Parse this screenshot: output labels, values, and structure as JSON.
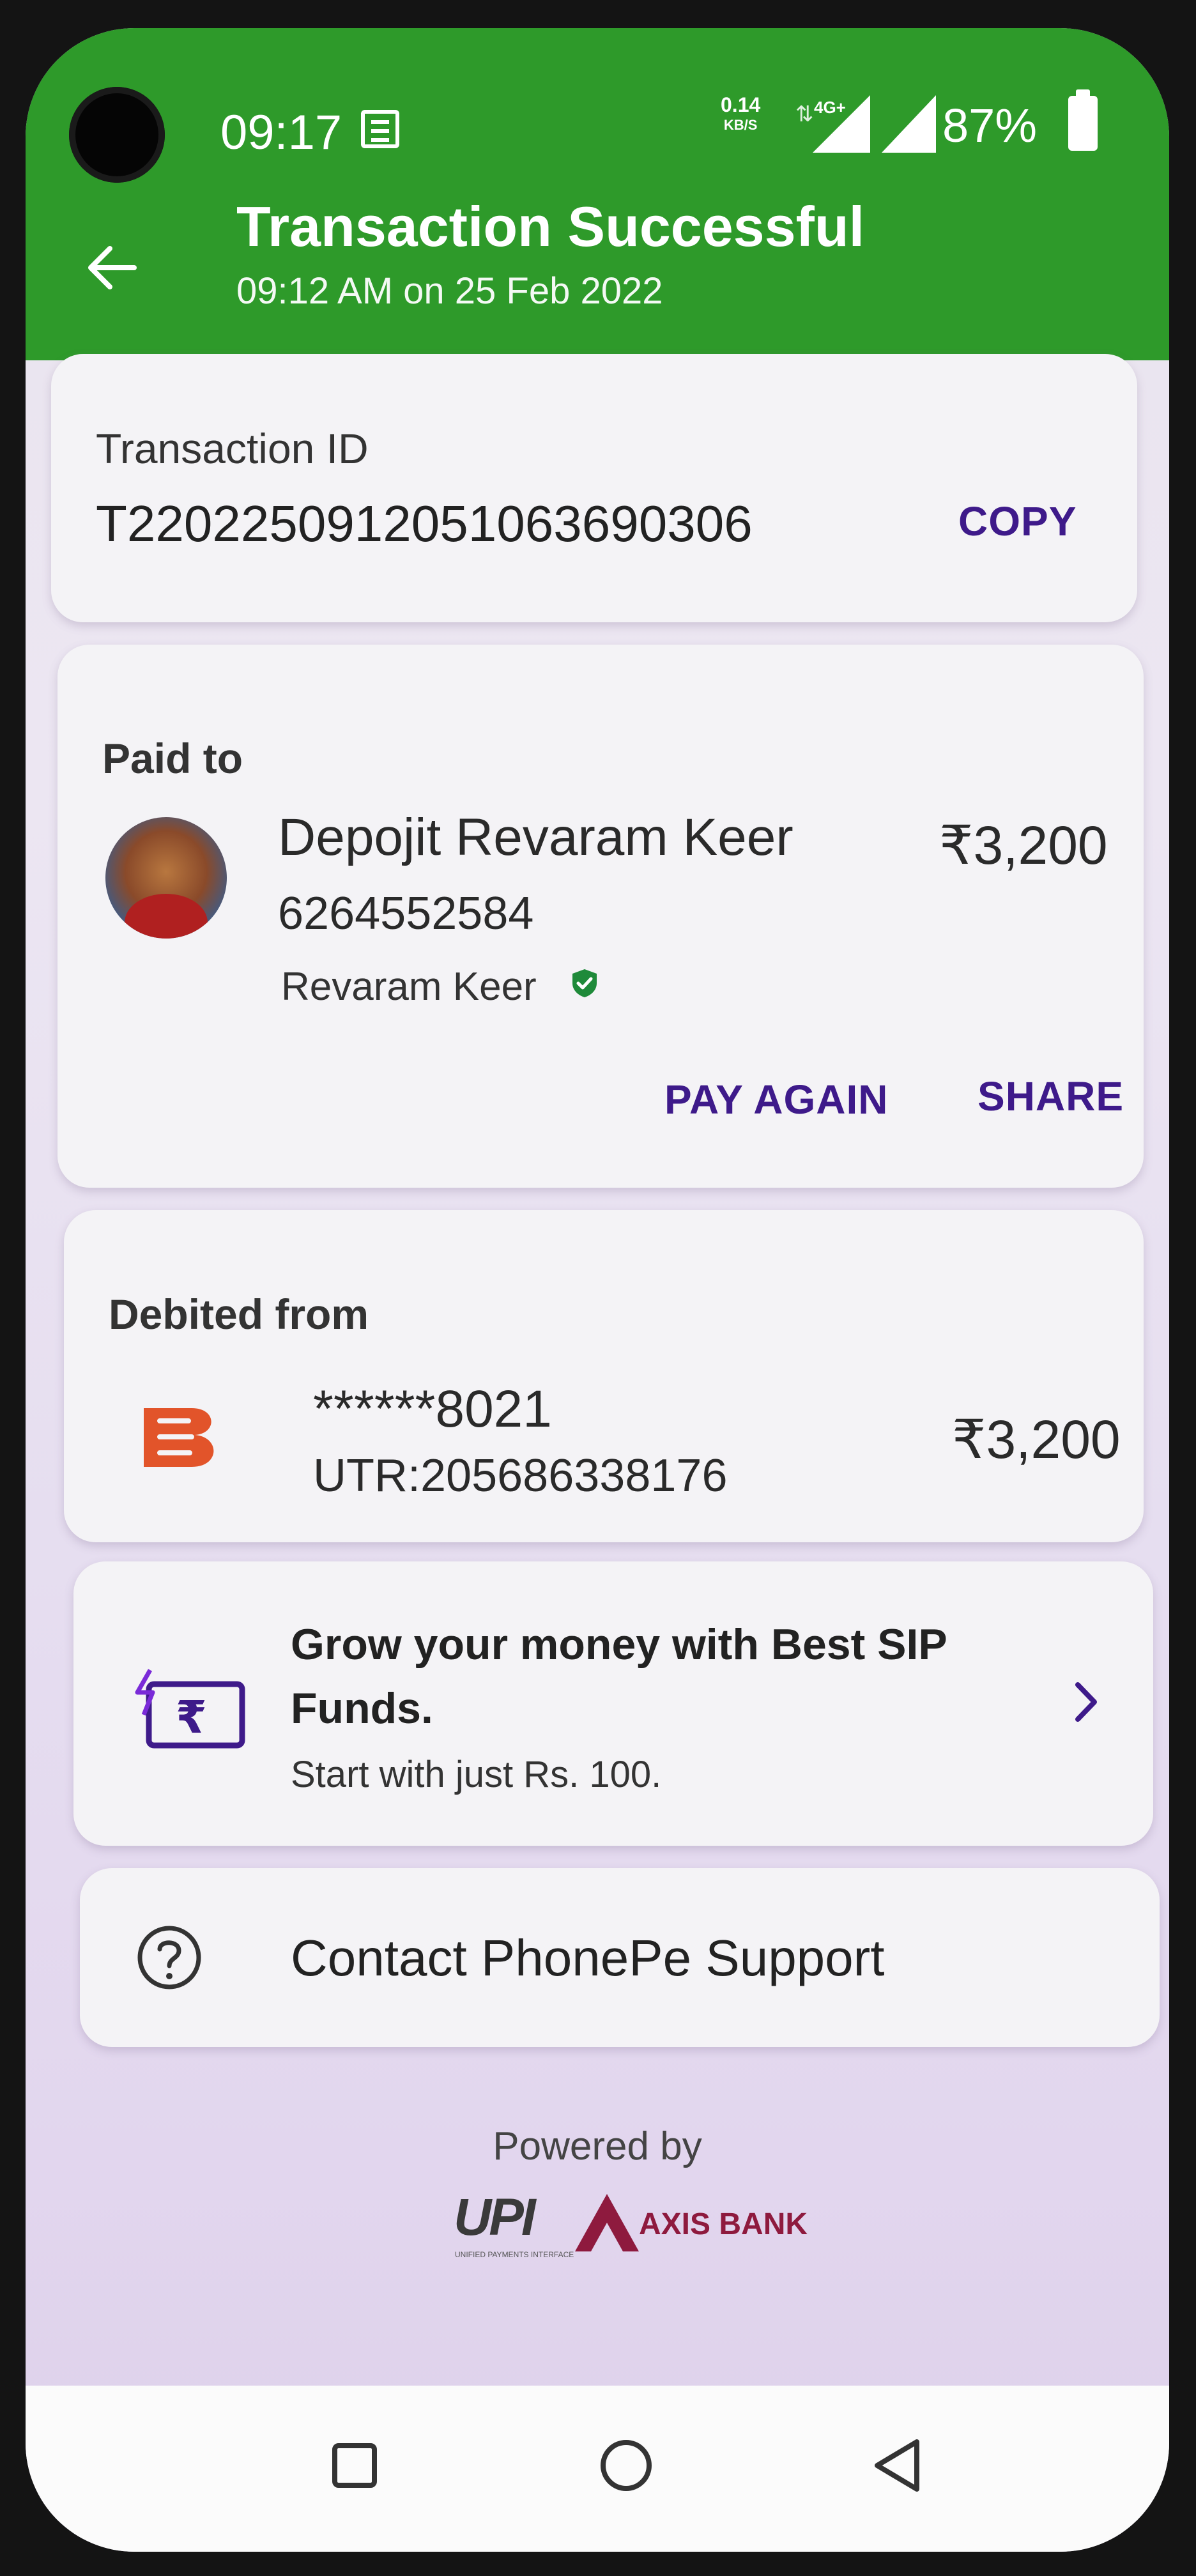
{
  "status_bar": {
    "time": "09:17",
    "net_speed_value": "0.14",
    "net_speed_unit": "KB/S",
    "network_type": "4G+",
    "battery_percent": "87%"
  },
  "header": {
    "title": "Transaction Successful",
    "subtitle": "09:12 AM on 25 Feb 2022",
    "bg_color": "#2e9a2a"
  },
  "transaction": {
    "id_label": "Transaction ID",
    "id_value": "T2202250912051063690306",
    "copy_label": "COPY"
  },
  "paid_to": {
    "section_label": "Paid to",
    "name": "Depojit Revaram Keer",
    "phone": "6264552584",
    "registered_name": "Revaram Keer",
    "amount": "₹3,200",
    "pay_again_label": "PAY AGAIN",
    "share_label": "SHARE",
    "verified_icon": "verified-shield-icon"
  },
  "debited_from": {
    "section_label": "Debited from",
    "account": "******8021",
    "utr": "UTR:205686338176",
    "amount": "₹3,200",
    "bank_icon": "bank-of-baroda-logo"
  },
  "promo": {
    "title": "Grow your money with Best SIP Funds.",
    "subtitle": "Start with just Rs. 100.",
    "icon": "sip-rupee-icon"
  },
  "support": {
    "label": "Contact PhonePe Support",
    "icon": "help-circle-icon"
  },
  "footer": {
    "powered_by": "Powered by",
    "upi_text": "UPI",
    "upi_subtext": "UNIFIED PAYMENTS INTERFACE",
    "axis_text": "AXIS BANK"
  },
  "colors": {
    "accent_purple": "#3e1a8a",
    "header_green": "#2e9a2a"
  }
}
